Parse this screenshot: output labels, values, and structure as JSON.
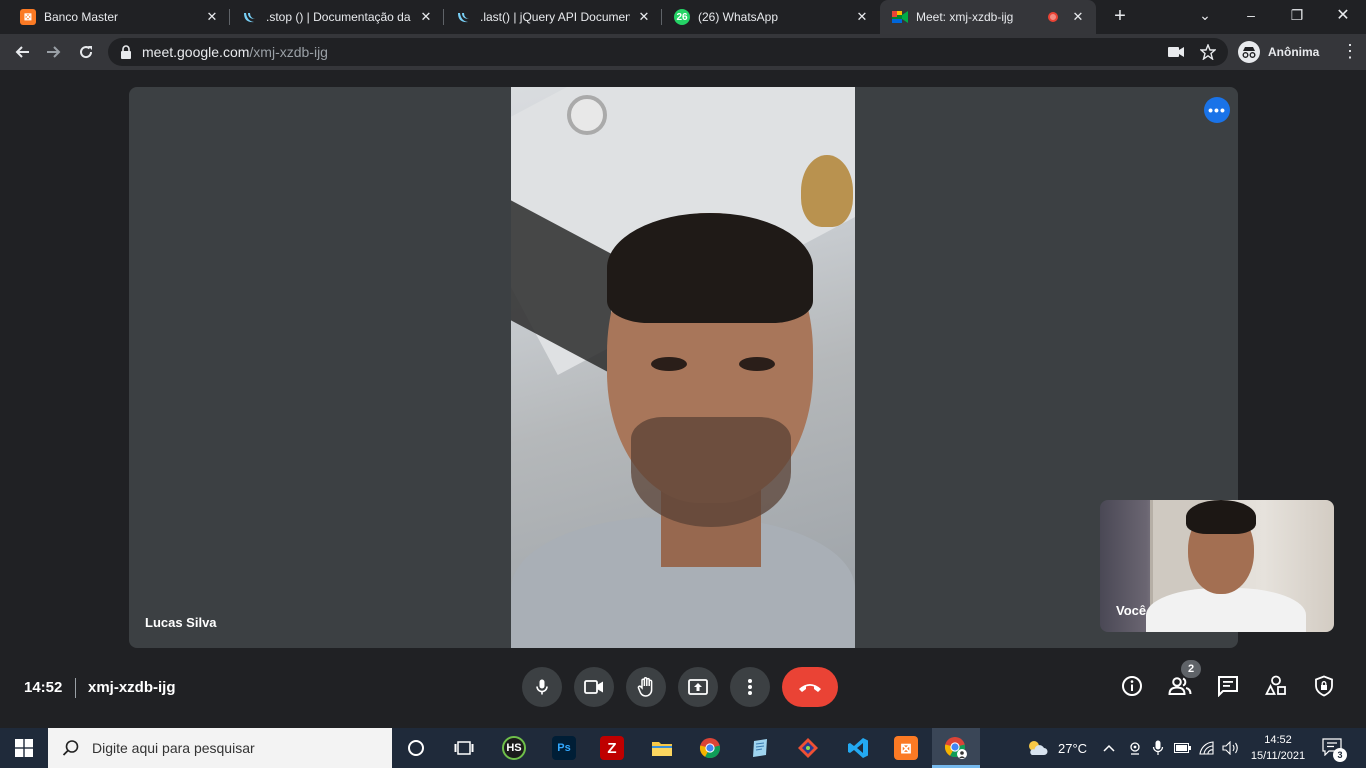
{
  "browser": {
    "tabs": [
      {
        "title": "Banco Master",
        "favicon": "xampp-icon",
        "color": "#fb7a24",
        "glyph": "⊠"
      },
      {
        "title": ".stop () | Documentação da A",
        "favicon": "jquery-icon",
        "color": "#0769ad",
        "glyph": ""
      },
      {
        "title": ".last() | jQuery API Document",
        "favicon": "jquery-icon",
        "color": "#0769ad",
        "glyph": ""
      },
      {
        "title": "(26) WhatsApp",
        "favicon": "whatsapp-icon",
        "color": "#25d366",
        "glyph": "26"
      },
      {
        "title": "Meet: xmj-xzdb-ijg",
        "favicon": "google-meet-icon",
        "color": "#00832d",
        "glyph": ""
      }
    ],
    "url_host": "meet.google.com",
    "url_path": "/xmj-xzdb-ijg",
    "profile_label": "Anônima"
  },
  "meet": {
    "main_participant": "Lucas Silva",
    "self_label": "Você",
    "time": "14:52",
    "meeting_code": "xmj-xzdb-ijg",
    "participant_count": "2",
    "hangup_color": "#ea4335",
    "accent": "#1a73e8"
  },
  "taskbar": {
    "search_placeholder": "Digite aqui para pesquisar",
    "weather": "27°C",
    "clock_time": "14:52",
    "clock_date": "15/11/2021",
    "notification_count": "3",
    "apps": [
      "cortana-icon",
      "task-view-icon",
      "hubspot-icon",
      "photoshop-icon",
      "filezilla-icon",
      "file-explorer-icon",
      "chrome-icon",
      "notepad-icon",
      "git-icon",
      "vscode-icon",
      "xampp-icon",
      "chrome-meet-icon"
    ]
  }
}
